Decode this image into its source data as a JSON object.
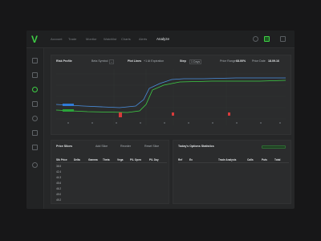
{
  "app": {
    "logo": "V",
    "nav": [
      "Account",
      "Trade",
      "Monitor",
      "Watchlist",
      "Charts",
      "Alerts",
      "Analyze"
    ],
    "active_nav": 6
  },
  "risk_profile": {
    "title": "Risk Profile",
    "beta_symbol_label": "Beta Symbol",
    "beta_symbol_value": "--",
    "plot_lines_label": "Plot Lines",
    "plot_lines_value": "+1 At Expiration",
    "step_label": "Step",
    "step_value": "1 Days",
    "price_range_label": "Price Range",
    "price_range_value": "68.00%",
    "price_date_label": "Price Date",
    "price_date_value": "18.09.16",
    "colors": {
      "blue": "#4a8fe0",
      "green": "#3ecf45",
      "red": "#d83b3b"
    }
  },
  "price_slices": {
    "title": "Price Slices",
    "actions": [
      "Add Slice",
      "Reorder",
      "Reset Slice"
    ],
    "columns": [
      "Stk Price",
      "Delta",
      "Gamma",
      "Theta",
      "Vega",
      "P/L Open",
      "P/L Day"
    ],
    "rows": [
      [
        "38.5",
        "",
        "",
        "",
        "",
        "",
        ""
      ],
      [
        "42.4",
        "",
        "",
        "",
        "",
        "",
        ""
      ],
      [
        "44.3",
        "",
        "",
        "",
        "",
        "",
        ""
      ],
      [
        "45.6",
        "",
        "",
        "",
        "",
        "",
        ""
      ],
      [
        "46.2",
        "",
        "",
        "",
        "",
        "",
        ""
      ],
      [
        "49.0",
        "",
        "",
        "",
        "",
        "",
        ""
      ],
      [
        "49.2",
        "",
        "",
        "",
        "",
        "",
        ""
      ]
    ]
  },
  "options_stats": {
    "title": "Today's Options Statistics",
    "columns": [
      "Ref",
      "Ex",
      "Trade Analysis",
      "Calls",
      "Puts",
      "Total"
    ],
    "rows": [
      {
        "ref": "",
        "ex": "",
        "analysis": "",
        "calls": "",
        "puts": "",
        "total": ""
      },
      {
        "ref": "",
        "ex": "",
        "analysis": "",
        "calls": "",
        "puts": "",
        "total": ""
      },
      {
        "ref": "",
        "ex": "",
        "analysis": "",
        "calls": "",
        "puts": "",
        "total": ""
      },
      {
        "ref": "",
        "ex": "",
        "analysis": "",
        "calls": "",
        "puts": "",
        "total": ""
      },
      {
        "ref": "",
        "ex": "",
        "analysis": "",
        "calls": "",
        "puts": "",
        "total": ""
      },
      {
        "ref": "",
        "ex": "",
        "analysis": "",
        "calls": "",
        "puts": "",
        "total": ""
      },
      {
        "ref": "",
        "ex": "",
        "analysis": "",
        "calls": "",
        "puts": "",
        "total": ""
      }
    ]
  }
}
